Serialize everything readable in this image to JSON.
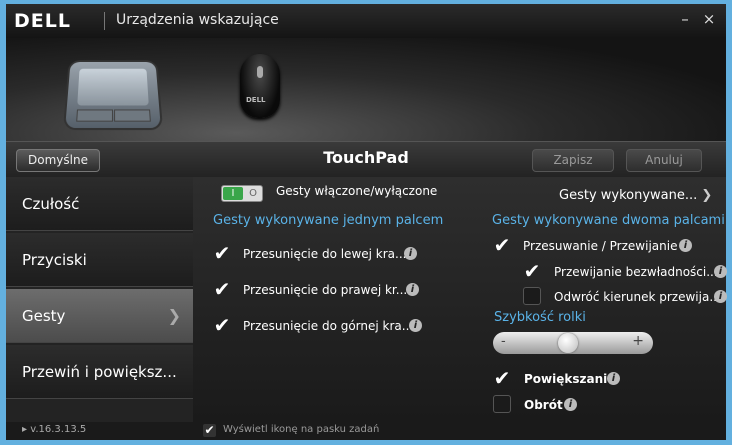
{
  "window": {
    "logo": "DELL",
    "title": "Urządzenia wskazujące",
    "minimize": "–",
    "close": "×"
  },
  "toolbar": {
    "default_label": "Domyślne",
    "page_title": "TouchPad",
    "save_label": "Zapisz",
    "cancel_label": "Anuluj"
  },
  "sidebar": {
    "items": [
      {
        "label": "Czułość"
      },
      {
        "label": "Przyciski"
      },
      {
        "label": "Gesty",
        "active": true
      },
      {
        "label": "Przewiń i powiększ..."
      }
    ],
    "version": "v.16.3.13.5"
  },
  "gestures": {
    "toggle_on": "I",
    "toggle_off": "O",
    "toggle_label": "Gesty włączone/wyłączone",
    "performed_link": "Gesty wykonywane...",
    "one_finger": {
      "title": "Gesty wykonywane jednym palcem",
      "items": [
        {
          "label": "Przesunięcie do lewej kra...",
          "checked": true
        },
        {
          "label": "Przesunięcie do prawej kr...",
          "checked": true
        },
        {
          "label": "Przesunięcie do górnej kra...",
          "checked": true
        }
      ]
    },
    "two_finger": {
      "title": "Gesty wykonywane dwoma palcami",
      "scroll_label": "Przesuwanie / Przewijanie",
      "inertia_label": "Przewijanie bezwładności...",
      "reverse_label": "Odwróć kierunek przewija...",
      "speed_title": "Szybkość rolki",
      "speed_minus": "-",
      "speed_plus": "+",
      "speed_value": 0.45,
      "zoom_label": "Powiększanie",
      "rotate_label": "Obrót"
    }
  },
  "footer": {
    "tray_icon_label": "Wyświetl ikonę na pasku zadań"
  },
  "colors": {
    "accent": "#5ab3e8",
    "border": "#63b0df",
    "toggle_on": "#3aa64a"
  }
}
